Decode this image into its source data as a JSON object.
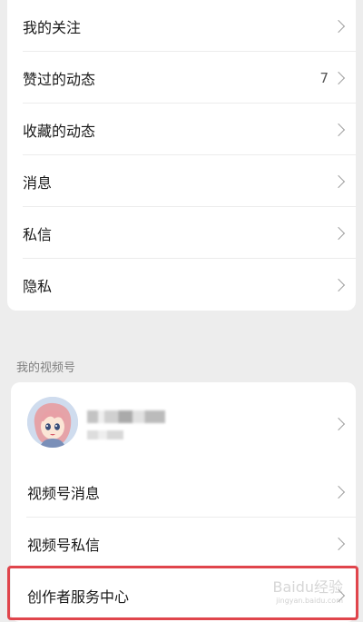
{
  "menu": {
    "items": [
      {
        "label": "我的关注",
        "count": ""
      },
      {
        "label": "赞过的动态",
        "count": "7"
      },
      {
        "label": "收藏的动态",
        "count": ""
      },
      {
        "label": "消息",
        "count": ""
      },
      {
        "label": "私信",
        "count": ""
      },
      {
        "label": "隐私",
        "count": ""
      }
    ]
  },
  "channels": {
    "section_title": "我的视频号",
    "items": [
      {
        "label": "视频号消息"
      },
      {
        "label": "视频号私信"
      },
      {
        "label": "创作者服务中心"
      }
    ]
  },
  "watermark": {
    "text": "Baidu经验",
    "sub": "jingyan.baidu.com"
  },
  "icons": {
    "chevron": "chevron-right-icon",
    "avatar": "anime-girl-avatar"
  },
  "colors": {
    "highlight": "#e0454c",
    "background": "#ededed",
    "card": "#ffffff"
  }
}
